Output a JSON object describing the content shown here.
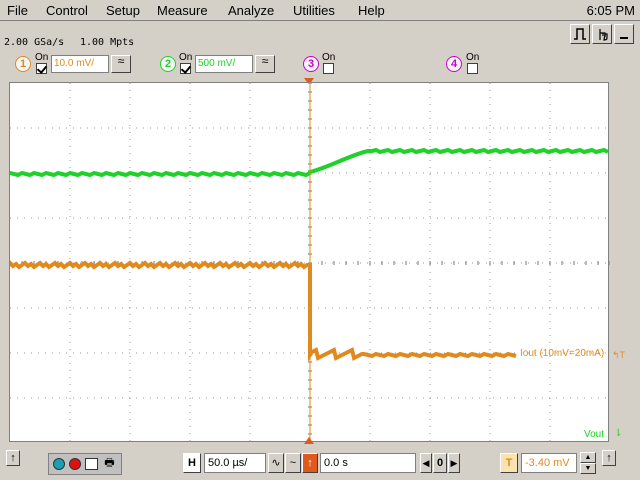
{
  "menu": {
    "file": "File",
    "control": "Control",
    "setup": "Setup",
    "measure": "Measure",
    "analyze": "Analyze",
    "utilities": "Utilities",
    "help": "Help",
    "clock": "6:05 PM"
  },
  "acquisition": {
    "sample_rate": "2.00 GSa/s",
    "memory_depth": "1.00 Mpts"
  },
  "channels": [
    {
      "number": "1",
      "on_label": "On",
      "on": true,
      "scale": "10.0 mV/",
      "color": "#ff8c00"
    },
    {
      "number": "2",
      "on_label": "On",
      "on": true,
      "scale": "500 mV/",
      "color": "#22cc22"
    },
    {
      "number": "3",
      "on_label": "On",
      "on": false,
      "scale": "",
      "color": "#cc00cc"
    },
    {
      "number": "4",
      "on_label": "On",
      "on": false,
      "scale": "",
      "color": "#cc00cc"
    }
  ],
  "trace_labels": {
    "iout": "Iout (10mV=20mA)",
    "vout": "Vout"
  },
  "timebase": {
    "h_label": "H",
    "scale": "50.0 µs/",
    "delay": "0.0 s"
  },
  "trigger": {
    "t_label": "T",
    "level": "-3.40 mV"
  },
  "colors": {
    "ch1": "#e08a1e",
    "ch2": "#1fd12a",
    "grid": "#9a9a9a"
  }
}
